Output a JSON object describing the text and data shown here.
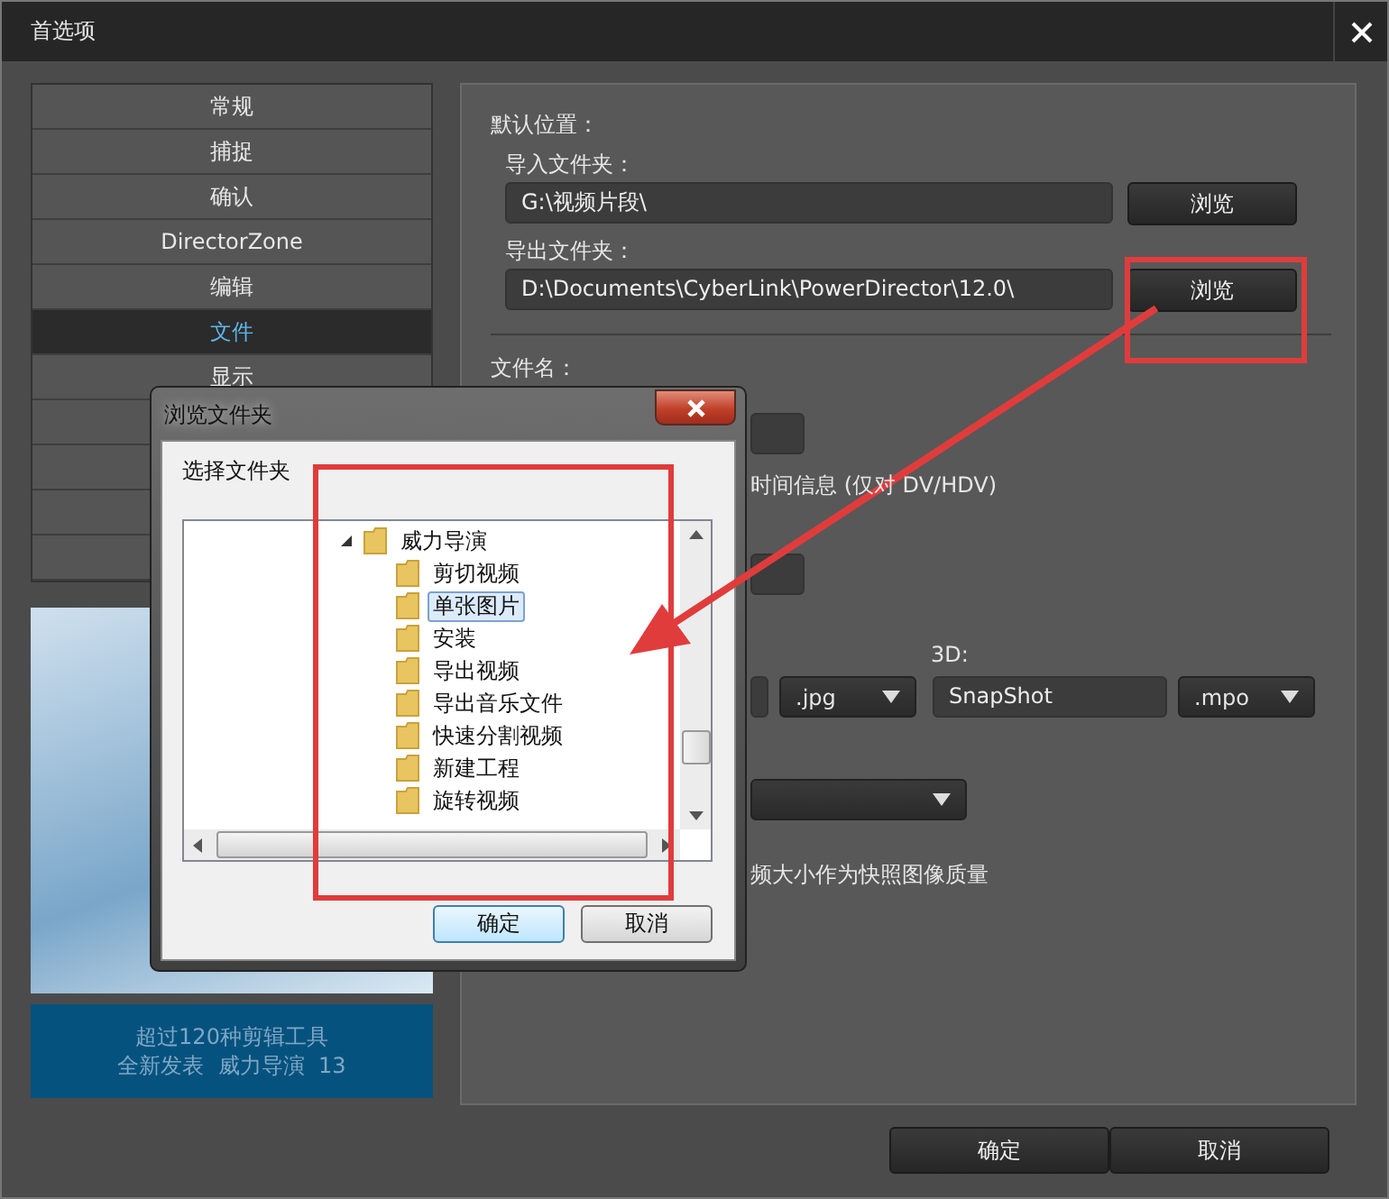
{
  "window": {
    "title": "首选项"
  },
  "sidebar": {
    "items": [
      {
        "label": "常规",
        "selected": false
      },
      {
        "label": "捕捉",
        "selected": false
      },
      {
        "label": "确认",
        "selected": false
      },
      {
        "label": "DirectorZone",
        "selected": false
      },
      {
        "label": "编辑",
        "selected": false
      },
      {
        "label": "文件",
        "selected": true
      },
      {
        "label": "显示",
        "selected": false
      }
    ]
  },
  "promo": {
    "lines": [
      "超过120种剪辑工具",
      "全新发表  威力导演  13"
    ]
  },
  "default_location": {
    "heading": "默认位置：",
    "import_label": "导入文件夹：",
    "import_path": "G:\\视频片段\\",
    "import_button": "浏览",
    "export_label": "导出文件夹：",
    "export_path": "D:\\Documents\\CyberLink\\PowerDirector\\12.0\\",
    "export_button": "浏览"
  },
  "file_name": {
    "heading": "文件名：",
    "timecode_text": "时间信息 (仅对 DV/HDV)",
    "label_3d": "3D:",
    "format_2d": ".jpg",
    "name_3d": "SnapShot",
    "format_3d": ".mpo",
    "quality_text": "频大小作为快照图像质量"
  },
  "footer_buttons": [
    "确定",
    "取消"
  ],
  "browse_dialog": {
    "title": "浏览文件夹",
    "prompt": "选择文件夹",
    "tree": [
      {
        "label": "威力导演",
        "expanded": true,
        "selected": false,
        "children": [
          {
            "label": "剪切视频",
            "selected": false
          },
          {
            "label": "单张图片",
            "selected": true
          },
          {
            "label": "安装",
            "selected": false
          },
          {
            "label": "导出视频",
            "selected": false
          },
          {
            "label": "导出音乐文件",
            "selected": false
          },
          {
            "label": "快速分割视频",
            "selected": false
          },
          {
            "label": "新建工程",
            "selected": false
          },
          {
            "label": "旋转视频",
            "selected": false
          }
        ]
      }
    ],
    "buttons": [
      {
        "label": "确定",
        "default": true
      },
      {
        "label": "取消",
        "default": false
      }
    ]
  }
}
